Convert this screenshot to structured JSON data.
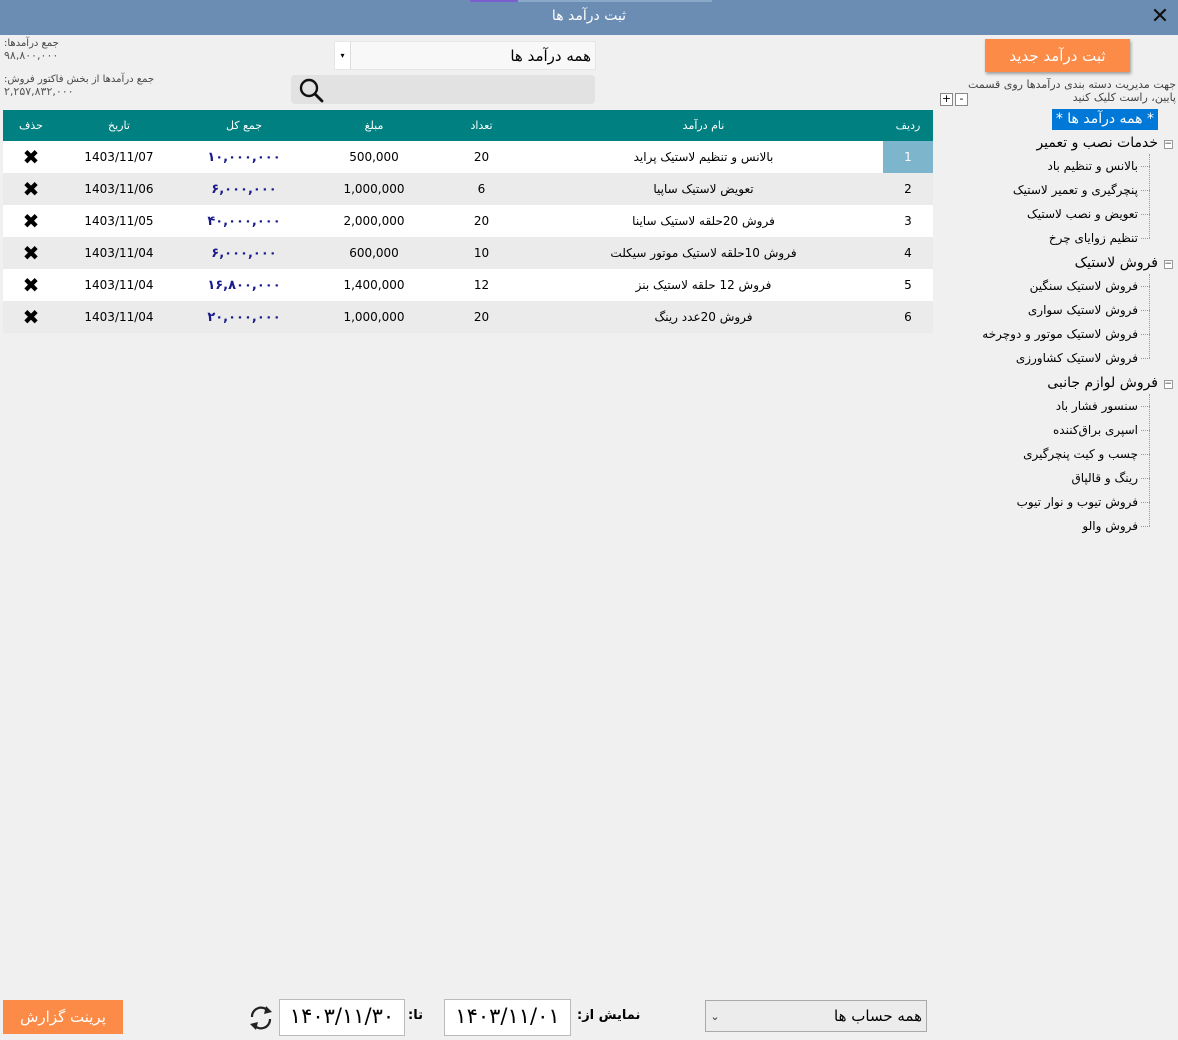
{
  "window": {
    "title": "ثبت درآمد ها",
    "close_symbol": "✕"
  },
  "stats": {
    "total_income_label": "جمع درآمدها:",
    "total_income_value": "۹۸,۸۰۰,۰۰۰",
    "invoice_income_label": "جمع درآمدها از بخش فاکتور فروش:",
    "invoice_income_value": "۲,۲۵۷,۸۳۲,۰۰۰"
  },
  "filter": {
    "selected": "همه درآمد ها"
  },
  "search": {
    "placeholder": ""
  },
  "table": {
    "headers": {
      "row": "ردیف",
      "name": "نام درآمد",
      "count": "تعداد",
      "amount": "مبلغ",
      "total": "جمع کل",
      "date": "تاریخ",
      "delete": "حذف"
    },
    "delete_symbol": "✖",
    "rows": [
      {
        "row": "1",
        "name": "بالانس و تنظیم لاستیک پراید",
        "count": "20",
        "amount": "500,000",
        "total": "۱۰,۰۰۰,۰۰۰",
        "date": "1403/11/07"
      },
      {
        "row": "2",
        "name": "تعویض لاستیک ساپیا",
        "count": "6",
        "amount": "1,000,000",
        "total": "۶,۰۰۰,۰۰۰",
        "date": "1403/11/06"
      },
      {
        "row": "3",
        "name": "فروش 20حلقه لاستیک ساینا",
        "count": "20",
        "amount": "2,000,000",
        "total": "۴۰,۰۰۰,۰۰۰",
        "date": "1403/11/05"
      },
      {
        "row": "4",
        "name": "فروش 10حلقه لاستیک موتور سیکلت",
        "count": "10",
        "amount": "600,000",
        "total": "۶,۰۰۰,۰۰۰",
        "date": "1403/11/04"
      },
      {
        "row": "5",
        "name": "فروش 12 حلقه لاستیک بنز",
        "count": "12",
        "amount": "1,400,000",
        "total": "۱۶,۸۰۰,۰۰۰",
        "date": "1403/11/04"
      },
      {
        "row": "6",
        "name": "فروش 20عدد رینگ",
        "count": "20",
        "amount": "1,000,000",
        "total": "۲۰,۰۰۰,۰۰۰",
        "date": "1403/11/04"
      }
    ]
  },
  "sidebar": {
    "add_button": "ثبت درآمد جدید",
    "hint": "جهت مدیریت دسته بندی درآمدها روی قسمت پایین، راست کلیک کنید",
    "plus": "+",
    "minus": "-",
    "tree": {
      "root": "* همه درآمد ها *",
      "categories": [
        {
          "label": "خدمات نصب و تعمیر",
          "items": [
            "بالانس و تنظیم باد",
            "پنچرگیری و تعمیر لاستیک",
            "تعویض و نصب لاستیک",
            "تنظیم زوایای چرخ"
          ]
        },
        {
          "label": "فروش لاستیک",
          "items": [
            "فروش لاستیک سنگین",
            "فروش لاستیک سواری",
            "فروش لاستیک موتور و دوچرخه",
            "فروش لاستیک کشاورزی"
          ]
        },
        {
          "label": "فروش لوازم جانبی",
          "items": [
            "سنسور فشار باد",
            "اسپری براق‌کننده",
            "چسب و کیت پنچرگیری",
            "رینگ و قالپاق",
            "فروش تیوب و نوار تیوب",
            "فروش والو"
          ]
        }
      ]
    }
  },
  "footer": {
    "print_button": "پرینت گزارش",
    "to_label": "تا:",
    "to_date": "۱۴۰۳/۱۱/۳۰",
    "from_label": "نمایش از:",
    "from_date": "۱۴۰۳/۱۱/۰۱",
    "account_selected": "همه حساب ها"
  },
  "colors": {
    "titlebar": "#6b8db3",
    "header": "#008080",
    "accent_button": "#fb8b47",
    "selected_tree": "#0078d7",
    "total_text": "#1a1a8c"
  }
}
